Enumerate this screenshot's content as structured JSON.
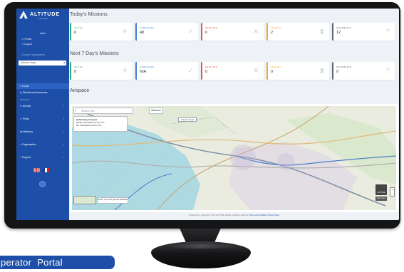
{
  "brand": {
    "name": "ALTITUDE",
    "sub": "ANGEL"
  },
  "sidebar": {
    "welcome": "Hello",
    "links": [
      "Profile",
      "Logout"
    ],
    "org_heading": "Choose Organisation",
    "org_select": "Altitude Angel",
    "items": [
      {
        "label": "Home",
        "active": true,
        "chevron": ""
      },
      {
        "label": "Situational Awareness",
        "active": false,
        "chevron": ""
      }
    ],
    "section_label": "MANAGE",
    "nav": [
      {
        "label": "Aircraft",
        "chevron": "›"
      },
      {
        "label": "Pilots",
        "chevron": "›"
      },
      {
        "label": "Missions",
        "chevron": "›"
      },
      {
        "label": "Organisation",
        "chevron": "›"
      },
      {
        "label": "Support",
        "chevron": "›"
      }
    ],
    "languages": [
      "English",
      "French"
    ]
  },
  "today": {
    "title": "Today's Missions",
    "cards": [
      {
        "label": "ACTIVE",
        "value": "6",
        "color": "#2ba87e",
        "icon": "plane-icon",
        "glyph": "✈"
      },
      {
        "label": "COMPLETED",
        "value": "48",
        "color": "#3f7fd4",
        "icon": "check-icon",
        "glyph": "✓"
      },
      {
        "label": "REJECTED",
        "value": "0",
        "color": "#e0573f",
        "icon": "close-icon",
        "glyph": "✕"
      },
      {
        "label": "PENDING",
        "value": "2",
        "color": "#f0a83c",
        "icon": "hourglass-icon",
        "glyph": "⧗"
      },
      {
        "label": "INCOMPLETE",
        "value": "12",
        "color": "#5c6470",
        "icon": "question-icon",
        "glyph": "?"
      }
    ]
  },
  "next7": {
    "title": "Next 7 Day's Missions",
    "cards": [
      {
        "label": "ACTIVE",
        "value": "0",
        "color": "#2ba87e",
        "icon": "plane-icon",
        "glyph": "✈"
      },
      {
        "label": "COMPLETED",
        "value": "N/A",
        "color": "#3f7fd4",
        "icon": "check-icon",
        "glyph": "✓"
      },
      {
        "label": "REJECTED",
        "value": "0",
        "color": "#e0573f",
        "icon": "close-icon",
        "glyph": "✕"
      },
      {
        "label": "PENDING",
        "value": "0",
        "color": "#f0a83c",
        "icon": "hourglass-icon",
        "glyph": "⧗"
      },
      {
        "label": "INCOMPLETE",
        "value": "0",
        "color": "#5c6470",
        "icon": "question-icon",
        "glyph": "?"
      }
    ]
  },
  "airspace": {
    "title": "Airspace",
    "search_placeholder": "Search for...",
    "measure_label": "Measure",
    "info_title": "Showing Airspace",
    "info_from_label": "From:",
    "info_from": "2021/06/18 07:30 UTC",
    "info_to_label": "To:",
    "info_to": "2021/06/18 08:30 UTC",
    "map_tag": "Altitude Angel",
    "zoom_hint": "Zoom in to see ground hazards",
    "logo_label": "ALTITUDE",
    "zoom_in": "+",
    "zoom_out": "−",
    "layer_label": "Map Layers"
  },
  "footer": {
    "powered": "Powered By",
    "copyright": "Copyright © 2021 ALTITUDE ANGEL. All Rights Reserved.",
    "terms": "Terms and Conditions",
    "privacy": "Privacy Policy"
  },
  "badge": {
    "text": "perator Portal"
  }
}
